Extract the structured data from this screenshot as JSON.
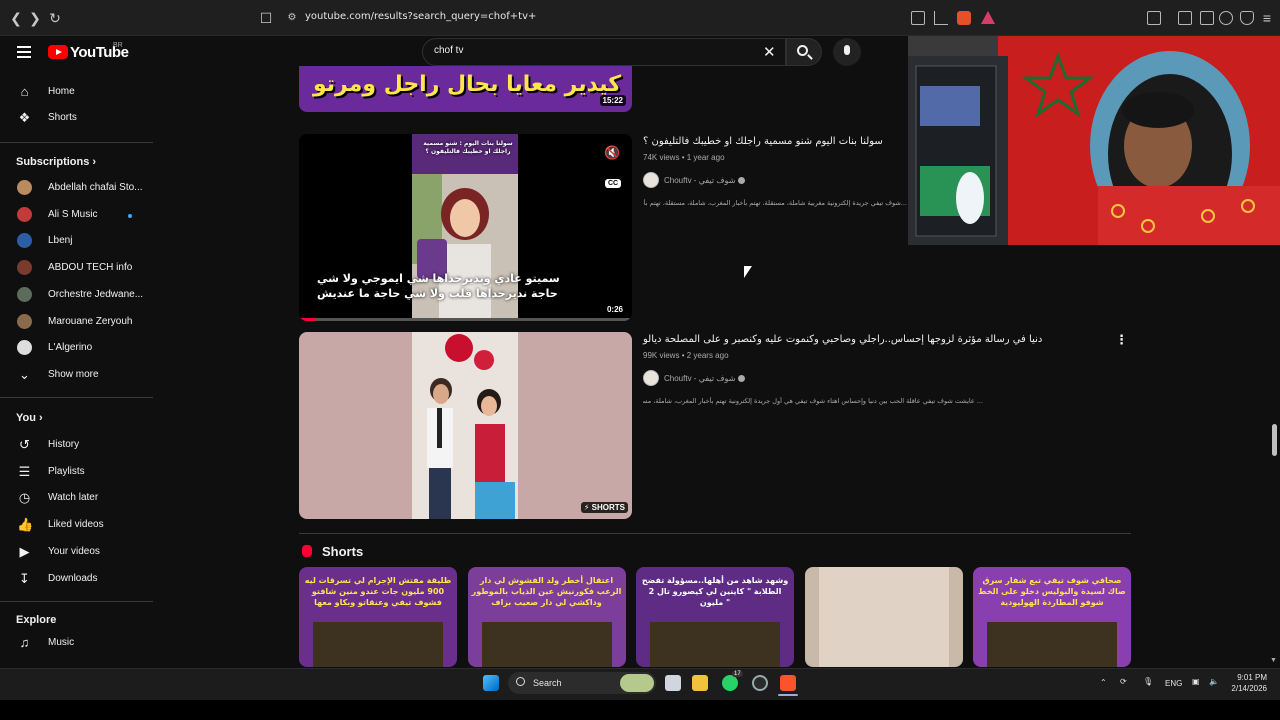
{
  "browser": {
    "url": "youtube.com/results?search_query=chof+tv+"
  },
  "logo": {
    "text": "YouTube",
    "country": "BR"
  },
  "search": {
    "query": "chof tv"
  },
  "sidebar": {
    "nav": [
      {
        "label": "Home",
        "icon": "home-icon"
      },
      {
        "label": "Shorts",
        "icon": "shorts-icon"
      }
    ],
    "subscriptions_heading": "Subscriptions",
    "subscriptions": [
      {
        "label": "Abdellah chafai Sto...",
        "color": "#b98b5e"
      },
      {
        "label": "Ali S Music",
        "color": "#c23a3a",
        "new": true
      },
      {
        "label": "Lbenj",
        "color": "#2a5fa8"
      },
      {
        "label": "ABDOU TECH info",
        "color": "#7a3b2e"
      },
      {
        "label": "Orchestre Jedwane...",
        "color": "#5c6b5c"
      },
      {
        "label": "Marouane Zeryouh",
        "color": "#8a6a4a"
      },
      {
        "label": "L'Algerino",
        "color": "#ddd"
      }
    ],
    "show_more": "Show more",
    "you_heading": "You",
    "you_items": [
      {
        "label": "History",
        "icon": "history-icon"
      },
      {
        "label": "Playlists",
        "icon": "playlists-icon"
      },
      {
        "label": "Watch later",
        "icon": "watch-later-icon"
      },
      {
        "label": "Liked videos",
        "icon": "like-icon"
      },
      {
        "label": "Your videos",
        "icon": "your-videos-icon"
      },
      {
        "label": "Downloads",
        "icon": "download-icon"
      }
    ],
    "explore_heading": "Explore",
    "explore_items": [
      {
        "label": "Music",
        "icon": "music-icon"
      }
    ]
  },
  "results": {
    "top_partial": {
      "caption": "كيدير معايا بحال راجل ومرتو",
      "duration": "15:22"
    },
    "video1": {
      "title": "سولنا بنات اليوم شنو مسمية راجلك او خطيبك فالتليفون ؟",
      "views": "74K views",
      "age": "1 year ago",
      "channel": "Chouftv - شوف تيفي",
      "description": "...شوف تيفي جريدة إلكترونية مغربية شاملة، مستقلة، تهتم بأخبار المغرب، شاملة، مستقلة، تهتم بأخبار اليوم والقضايا السياسية والاقتصادية",
      "thumb_top": "سولنا بنات اليوم : شنو مسمية راجلك او خطيبك فالتليفون ؟",
      "caption_line1": "سميتو عادي ونديرحداها شي ايموجي ولا شي",
      "caption_line2": "حاجة نديرحداها قلب ولا شي حاجة ما عنديش",
      "duration": "0:26",
      "cc": "CC"
    },
    "video2": {
      "title": "دنيا في رسالة مؤثرة لزوجها إحساس..راجلي وصاحبي وكنموت عليه وكنصبر و على المصلحة ديالو",
      "views": "99K views",
      "age": "2 years ago",
      "channel": "Chouftv - شوف تيفي",
      "description": "... عايشت شوف تيفي عاقلة الحب بين دنيا وإحساس اهتاء شوف تيفي هي أول جريدة إلكترونية تهتم بأخبار المغرب، شاملة، مستقلة، دعم",
      "badge": "SHORTS"
    }
  },
  "shorts": {
    "heading": "Shorts",
    "items": [
      {
        "caption": "طليقة مفتش الإجرام لي تسرقات ليه 900 مليون جات عندو منين شافتو فشوف تيفي وعنقاتو وبكاو معها",
        "bg": "#6a2f8c"
      },
      {
        "caption": "اعتقال أخطر ولد الفشوش لي دار الرعب فكورنيش عين الذياب بالموطور وداكشي لي دار صعيب بزاف",
        "bg": "#7b3e9a"
      },
      {
        "caption": "وشهد شاهد من أهلها..مسؤولة تفضح الطلابة \" كاينين لي كيصورو تال 2 مليون \"",
        "bg": "#5e2c85"
      },
      {
        "caption": "",
        "bg": "#c9b9a8"
      },
      {
        "caption": "صحافي شوف تيفي تبع شفار سرق صاك لسيدة والبوليس دخلو على الخط شوفو المطاردة الهوليودية",
        "bg": "#8a3fb0"
      }
    ]
  },
  "taskbar": {
    "search_label": "Search",
    "lang": "ENG",
    "time": "9:01 PM",
    "date": "2/14/2026",
    "whatsapp_count": "17"
  }
}
